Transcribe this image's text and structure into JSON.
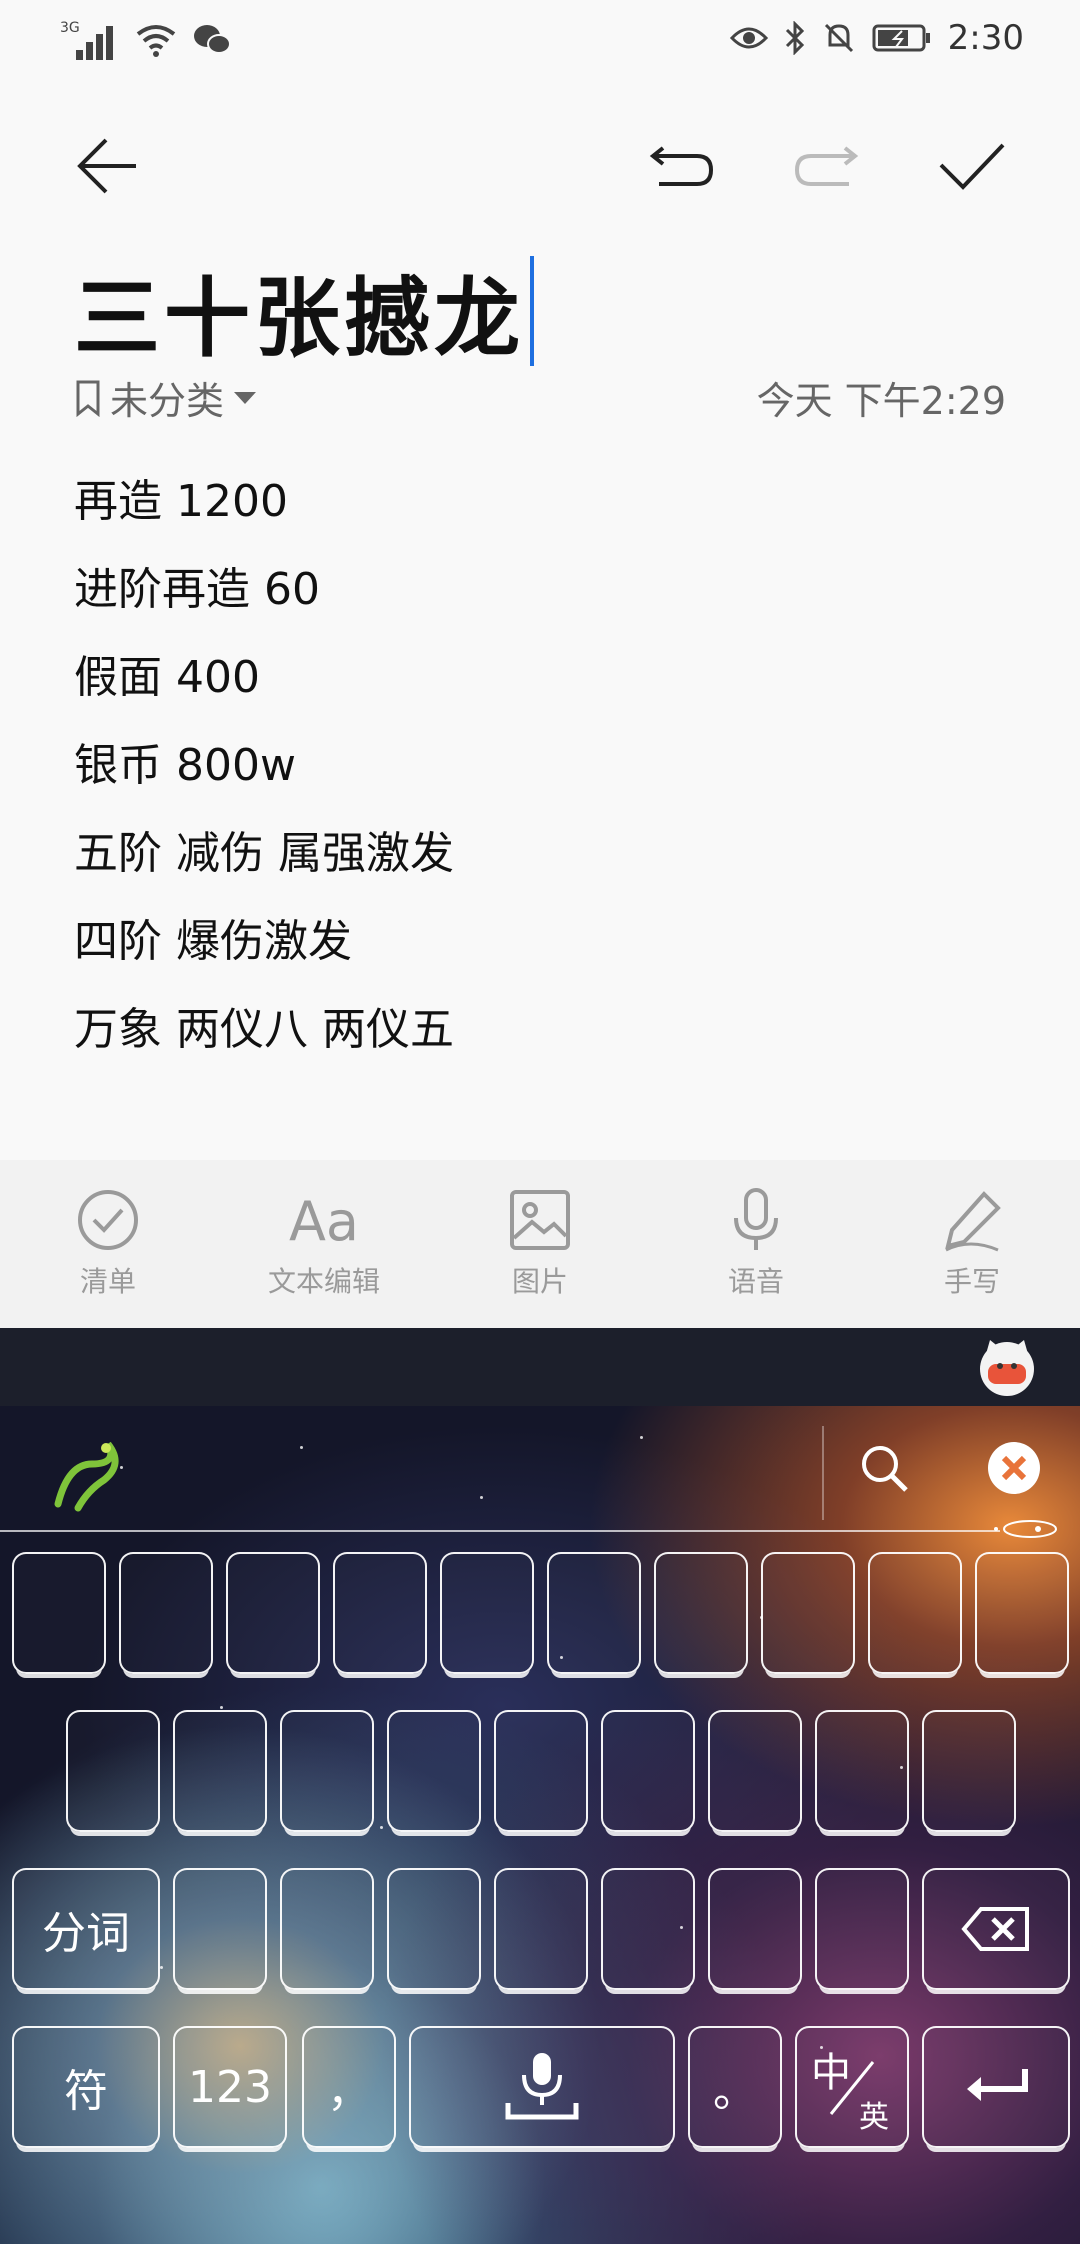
{
  "status_bar": {
    "network": "3G",
    "time": "2:30"
  },
  "toolbar": {
    "back": "back",
    "undo": "undo",
    "redo": "redo",
    "confirm": "confirm"
  },
  "note": {
    "title": "三十张撼龙",
    "category": "未分类",
    "timestamp": "今天 下午2:29",
    "lines": [
      "再造 1200",
      "进阶再造 60",
      "假面 400",
      "银币 800w",
      "五阶 减伤 属强激发",
      "四阶 爆伤激发",
      "万象 两仪八 两仪五"
    ]
  },
  "bottom_tools": [
    {
      "icon": "checklist-icon",
      "label": "清单"
    },
    {
      "icon": "text-format-icon",
      "label": "文本编辑"
    },
    {
      "icon": "image-icon",
      "label": "图片"
    },
    {
      "icon": "microphone-icon",
      "label": "语音"
    },
    {
      "icon": "pen-icon",
      "label": "手写"
    }
  ],
  "keyboard": {
    "row3_left": "分词",
    "row4": {
      "symbols": "符",
      "numbers": "123",
      "comma": "，",
      "period": "。",
      "lang_top": "中",
      "lang_bottom": "英"
    }
  },
  "colors": {
    "caret": "#1e6fe0",
    "tool_gray": "#9a9a9a",
    "kb_top": "#1c1f2b"
  }
}
